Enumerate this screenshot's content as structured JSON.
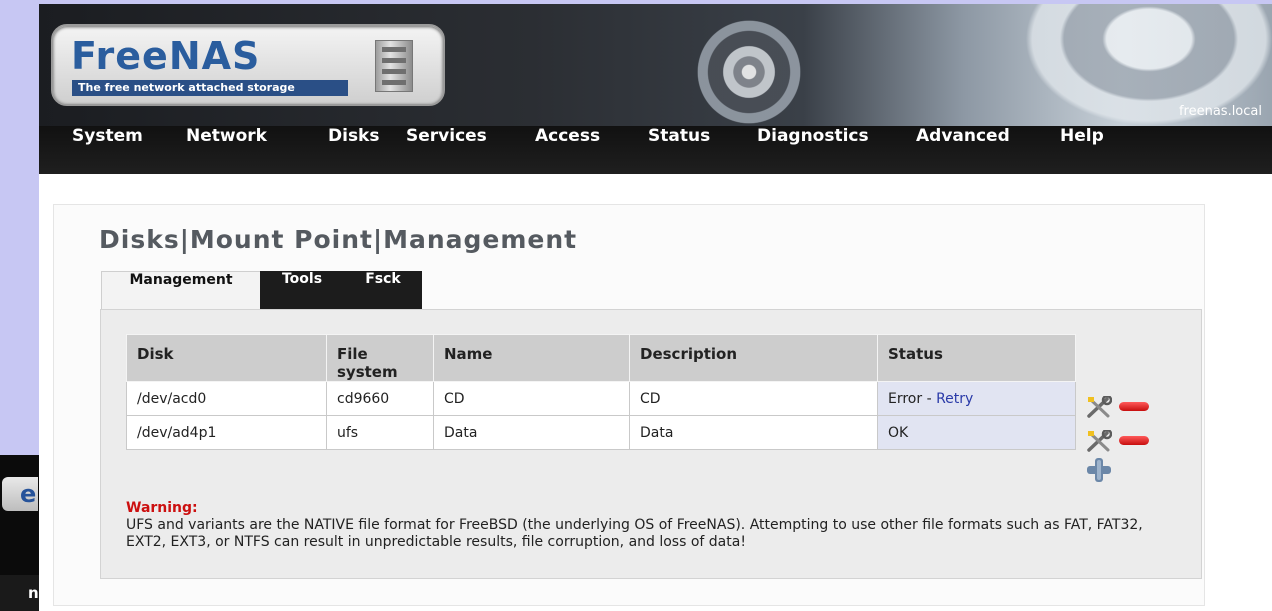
{
  "header": {
    "logo_title": "FreeNAS",
    "logo_tagline": "The free network attached storage",
    "hostname": "freenas.local"
  },
  "nav": {
    "items": [
      "System",
      "Network",
      "Disks",
      "Services",
      "Access",
      "Status",
      "Diagnostics",
      "Advanced",
      "Help"
    ]
  },
  "page": {
    "title": "Disks|Mount Point|Management"
  },
  "tabs": [
    {
      "label": "Management",
      "active": true
    },
    {
      "label": "Tools",
      "active": false
    },
    {
      "label": "Fsck",
      "active": false
    }
  ],
  "table": {
    "headers": {
      "disk": "Disk",
      "fs_line1": "File",
      "fs_line2": "system",
      "name": "Name",
      "description": "Description",
      "status": "Status"
    },
    "rows": [
      {
        "disk": "/dev/acd0",
        "fs": "cd9660",
        "name": "CD",
        "description": "CD",
        "status": "Error",
        "status_sep": " - ",
        "action": "Retry"
      },
      {
        "disk": "/dev/ad4p1",
        "fs": "ufs",
        "name": "Data",
        "description": "Data",
        "status": "OK"
      }
    ]
  },
  "warning": {
    "title": "Warning:",
    "text": "UFS and variants are the NATIVE file format for FreeBSD (the underlying OS of FreeNAS). Attempting to use other file formats such as FAT, FAT32, EXT2, EXT3, or NTFS can result in unpredictable results, file corruption, and loss of data!"
  },
  "background_window": {
    "logo_fragment": "e",
    "nav_fragment": "n"
  },
  "colors": {
    "desktop": "#c7c7f3",
    "brand_blue": "#2a5d9e",
    "warning_red": "#cc1010",
    "link_blue": "#2a3aa8"
  },
  "icons": [
    "tools-icon",
    "remove-icon",
    "add-icon",
    "server-icon"
  ]
}
